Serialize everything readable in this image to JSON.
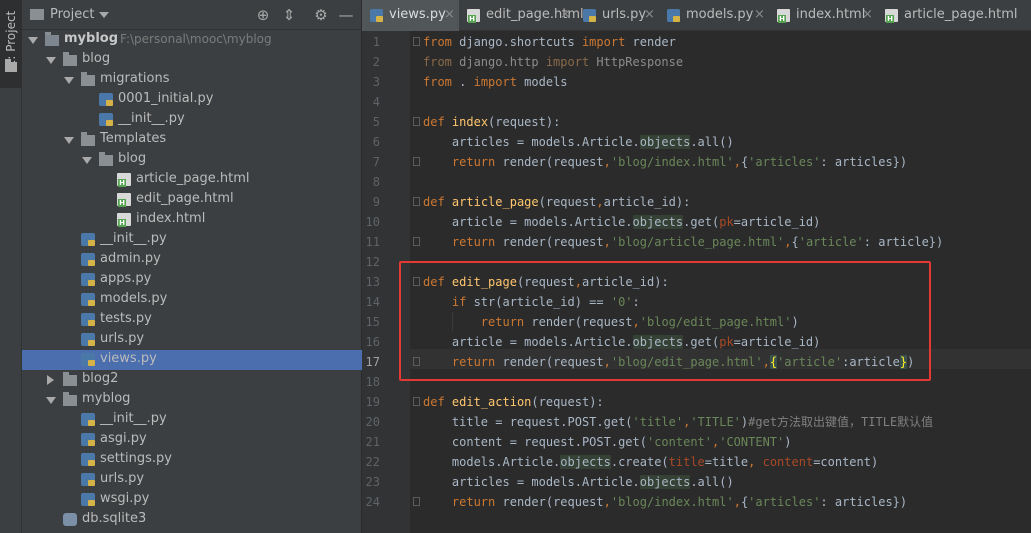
{
  "tool_window": {
    "label": "1: Project"
  },
  "project_panel": {
    "title": "Project",
    "tree": [
      {
        "label": "myblog",
        "path": "F:\\personal\\mooc\\myblog",
        "type": "root",
        "depth": 0,
        "open": true
      },
      {
        "label": "blog",
        "type": "folder",
        "depth": 1,
        "open": true
      },
      {
        "label": "migrations",
        "type": "folder",
        "depth": 2,
        "open": true
      },
      {
        "label": "0001_initial.py",
        "type": "py",
        "depth": 3
      },
      {
        "label": "__init__.py",
        "type": "py",
        "depth": 3
      },
      {
        "label": "Templates",
        "type": "folder",
        "depth": 2,
        "open": true
      },
      {
        "label": "blog",
        "type": "folder",
        "depth": 3,
        "open": true
      },
      {
        "label": "article_page.html",
        "type": "html",
        "depth": 4
      },
      {
        "label": "edit_page.html",
        "type": "html",
        "depth": 4
      },
      {
        "label": "index.html",
        "type": "html",
        "depth": 4
      },
      {
        "label": "__init__.py",
        "type": "py",
        "depth": 2
      },
      {
        "label": "admin.py",
        "type": "py",
        "depth": 2
      },
      {
        "label": "apps.py",
        "type": "py",
        "depth": 2
      },
      {
        "label": "models.py",
        "type": "py",
        "depth": 2
      },
      {
        "label": "tests.py",
        "type": "py",
        "depth": 2
      },
      {
        "label": "urls.py",
        "type": "py",
        "depth": 2
      },
      {
        "label": "views.py",
        "type": "py",
        "depth": 2,
        "selected": true
      },
      {
        "label": "blog2",
        "type": "folder",
        "depth": 1,
        "open": false
      },
      {
        "label": "myblog",
        "type": "folder",
        "depth": 1,
        "open": true
      },
      {
        "label": "__init__.py",
        "type": "py",
        "depth": 2
      },
      {
        "label": "asgi.py",
        "type": "py",
        "depth": 2
      },
      {
        "label": "settings.py",
        "type": "py",
        "depth": 2
      },
      {
        "label": "urls.py",
        "type": "py",
        "depth": 2
      },
      {
        "label": "wsgi.py",
        "type": "py",
        "depth": 2
      },
      {
        "label": "db.sqlite3",
        "type": "db",
        "depth": 1
      }
    ]
  },
  "tabs": [
    {
      "label": "views.py",
      "type": "py",
      "active": true
    },
    {
      "label": "edit_page.html",
      "type": "html"
    },
    {
      "label": "urls.py",
      "type": "py"
    },
    {
      "label": "models.py",
      "type": "py"
    },
    {
      "label": "index.html",
      "type": "html"
    },
    {
      "label": "article_page.html",
      "type": "html"
    }
  ],
  "editor": {
    "current_line": 17,
    "highlighted_lines": "13-17",
    "lines": [
      {
        "n": 1,
        "text": "from django.shortcuts import render"
      },
      {
        "n": 2,
        "text": "from django.http import HttpResponse"
      },
      {
        "n": 3,
        "text": "from . import models"
      },
      {
        "n": 4,
        "text": ""
      },
      {
        "n": 5,
        "text": "def index(request):"
      },
      {
        "n": 6,
        "text": "    articles = models.Article.objects.all()"
      },
      {
        "n": 7,
        "text": "    return render(request,'blog/index.html',{'articles': articles})"
      },
      {
        "n": 8,
        "text": ""
      },
      {
        "n": 9,
        "text": "def article_page(request,article_id):"
      },
      {
        "n": 10,
        "text": "    article = models.Article.objects.get(pk=article_id)"
      },
      {
        "n": 11,
        "text": "    return render(request,'blog/article_page.html',{'article': article})"
      },
      {
        "n": 12,
        "text": ""
      },
      {
        "n": 13,
        "text": "def edit_page(request,article_id):"
      },
      {
        "n": 14,
        "text": "    if str(article_id) == '0':"
      },
      {
        "n": 15,
        "text": "        return render(request,'blog/edit_page.html')"
      },
      {
        "n": 16,
        "text": "    article = models.Article.objects.get(pk=article_id)"
      },
      {
        "n": 17,
        "text": "    return render(request,'blog/edit_page.html',{'article':article})"
      },
      {
        "n": 18,
        "text": ""
      },
      {
        "n": 19,
        "text": "def edit_action(request):"
      },
      {
        "n": 20,
        "text": "    title = request.POST.get('title','TITLE')#get方法取出键值，TITLE默认值"
      },
      {
        "n": 21,
        "text": "    content = request.POST.get('content','CONTENT')"
      },
      {
        "n": 22,
        "text": "    models.Article.objects.create(title=title, content=content)"
      },
      {
        "n": 23,
        "text": "    articles = models.Article.objects.all()"
      },
      {
        "n": 24,
        "text": "    return render(request,'blog/index.html',{'articles': articles})"
      }
    ]
  },
  "colors": {
    "highlight_box": "#e53935",
    "selection": "#4b6eaf",
    "keyword": "#cc7832",
    "string": "#6a8759",
    "function": "#ffc66d"
  }
}
